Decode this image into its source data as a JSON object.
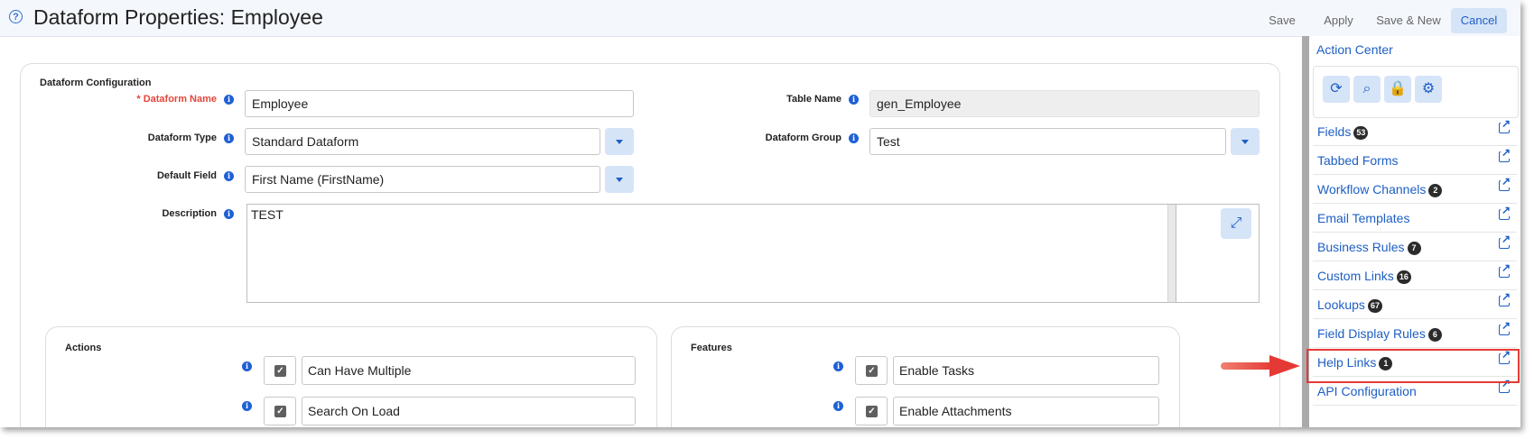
{
  "header": {
    "title": "Dataform Properties: Employee",
    "buttons": {
      "save": "Save",
      "apply": "Apply",
      "save_new": "Save & New",
      "cancel": "Cancel"
    }
  },
  "config": {
    "section_title": "Dataform Configuration",
    "dataform_name": {
      "required_mark": "*",
      "label": "Dataform Name",
      "value": "Employee"
    },
    "table_name": {
      "label": "Table Name",
      "value": "gen_Employee"
    },
    "dataform_type": {
      "label": "Dataform Type",
      "value": "Standard Dataform"
    },
    "dataform_group": {
      "label": "Dataform Group",
      "value": "Test"
    },
    "default_field": {
      "label": "Default Field",
      "value": "First Name (FirstName)"
    },
    "description": {
      "label": "Description",
      "value": "TEST"
    }
  },
  "actions": {
    "title": "Actions",
    "items": [
      {
        "label": "Can Have Multiple"
      },
      {
        "label": "Search On Load"
      }
    ]
  },
  "features": {
    "title": "Features",
    "items": [
      {
        "label": "Enable Tasks"
      },
      {
        "label": "Enable Attachments"
      }
    ]
  },
  "sidebar": {
    "header": "Action Center",
    "items": [
      {
        "label": "Fields",
        "badge": "53"
      },
      {
        "label": "Tabbed Forms",
        "badge": ""
      },
      {
        "label": "Workflow Channels",
        "badge": "2"
      },
      {
        "label": "Email Templates",
        "badge": ""
      },
      {
        "label": "Business Rules",
        "badge": "7"
      },
      {
        "label": "Custom Links",
        "badge": "16"
      },
      {
        "label": "Lookups",
        "badge": "67"
      },
      {
        "label": "Field Display Rules",
        "badge": "6"
      },
      {
        "label": "Help Links",
        "badge": "1"
      },
      {
        "label": "API Configuration",
        "badge": ""
      }
    ]
  },
  "colors": {
    "accent": "#1e5fc4",
    "highlight": "#e53935"
  }
}
